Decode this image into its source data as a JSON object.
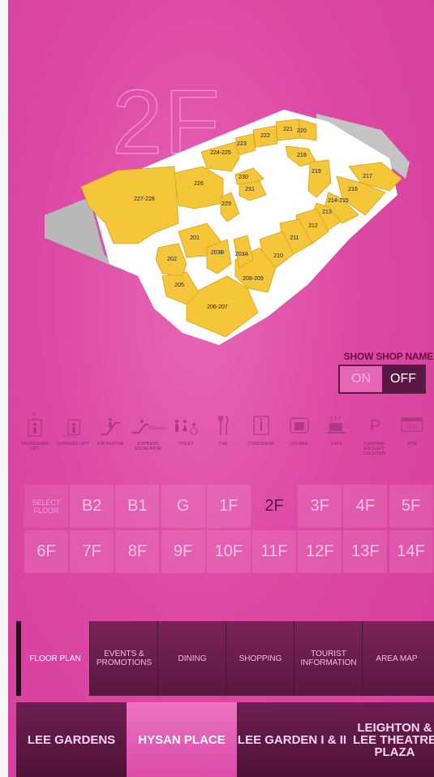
{
  "floor_title": "2F",
  "map": {
    "units": [
      "227-228",
      "226",
      "224-225",
      "223",
      "222",
      "221",
      "220",
      "218",
      "219",
      "217",
      "216",
      "214-215",
      "213",
      "212",
      "211",
      "210",
      "208-209",
      "206-207",
      "205",
      "202",
      "201",
      "203B",
      "203A",
      "229",
      "230",
      "231"
    ]
  },
  "toggle": {
    "title": "SHOW SHOP NAME",
    "on": "ON",
    "off": "OFF",
    "selected": "OFF"
  },
  "legend": [
    {
      "icon": "passenger-lift-icon",
      "label": "PASSENGER LIFT"
    },
    {
      "icon": "express-lift-icon",
      "label": "EXPRESS LIFT"
    },
    {
      "icon": "escalator-icon",
      "label": "ESCALATOR"
    },
    {
      "icon": "express-escalator-icon",
      "label": "EXPRESS ESCALATOR"
    },
    {
      "icon": "toilet-icon",
      "label": "TOILET"
    },
    {
      "icon": "fnb-icon",
      "label": "F&B"
    },
    {
      "icon": "concierge-icon",
      "label": "CONCIERGE"
    },
    {
      "icon": "locker-icon",
      "label": "LOCKER"
    },
    {
      "icon": "cafe-icon",
      "label": "CAFE"
    },
    {
      "icon": "carpark-icon",
      "label": "CARPARK ENQUIRY COUNTER"
    },
    {
      "icon": "atm-icon",
      "label": "ATM"
    }
  ],
  "floors": {
    "select_label": "SELECT FLOOR",
    "row1": [
      "B2",
      "B1",
      "G",
      "1F",
      "2F",
      "3F",
      "4F",
      "5F"
    ],
    "row2": [
      "6F",
      "7F",
      "8F",
      "9F",
      "10F",
      "11F",
      "12F",
      "13F",
      "14F"
    ],
    "current": "2F"
  },
  "nav": [
    "FLOOR PLAN",
    "EVENTS & PROMOTIONS",
    "DINING",
    "SHOPPING",
    "TOURIST INFORMATION",
    "AREA MAP"
  ],
  "malls": [
    "LEE GARDENS",
    "HYSAN PLACE",
    "LEE GARDEN I & II",
    "LEIGHTON & LEE THEATRE PLAZA"
  ],
  "colors": {
    "background": "#d9419f",
    "shop": "#f5c63a",
    "accent_dark": "#5b1744"
  }
}
